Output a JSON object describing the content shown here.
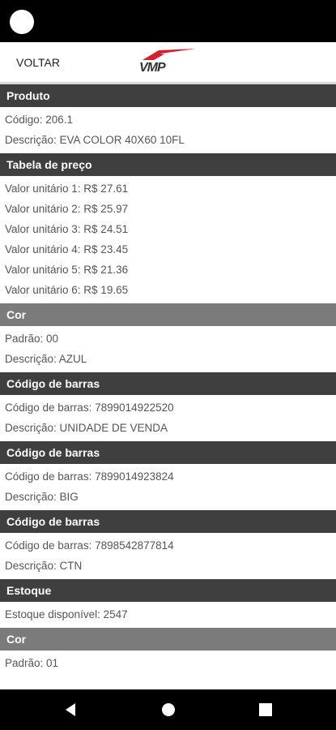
{
  "header": {
    "back_label": "VOLTAR",
    "logo_text": "VMP"
  },
  "sections": [
    {
      "title": "Produto",
      "shade": "dark",
      "rows": [
        "Código: 206.1",
        "Descrição: EVA COLOR 40X60 10FL"
      ]
    },
    {
      "title": "Tabela de preço",
      "shade": "dark",
      "rows": [
        "Valor unitário 1: R$ 27.61",
        "Valor unitário 2: R$ 25.97",
        "Valor unitário 3: R$ 24.51",
        "Valor unitário 4: R$ 23.45",
        "Valor unitário 5: R$ 21.36",
        "Valor unitário 6: R$ 19.65"
      ]
    },
    {
      "title": "Cor",
      "shade": "light",
      "rows": [
        "Padrão: 00",
        "Descrição: AZUL"
      ]
    },
    {
      "title": "Código de barras",
      "shade": "dark",
      "rows": [
        "Código de barras: 7899014922520",
        "Descrição: UNIDADE DE VENDA"
      ]
    },
    {
      "title": "Código de barras",
      "shade": "dark",
      "rows": [
        "Código de barras: 7899014923824",
        "Descrição: BIG"
      ]
    },
    {
      "title": "Código de barras",
      "shade": "dark",
      "rows": [
        "Código de barras: 7898542877814",
        "Descrição: CTN"
      ]
    },
    {
      "title": "Estoque",
      "shade": "dark",
      "rows": [
        "Estoque disponível: 2547"
      ]
    },
    {
      "title": "Cor",
      "shade": "light",
      "rows": [
        "Padrão: 01"
      ]
    }
  ],
  "nav": {
    "back_icon": "triangle-back-icon",
    "home_icon": "circle-home-icon",
    "recents_icon": "square-recents-icon"
  },
  "colors": {
    "section_dark": "#3f3f3f",
    "section_light": "#7b7b7b",
    "logo_red": "#d4202a"
  }
}
